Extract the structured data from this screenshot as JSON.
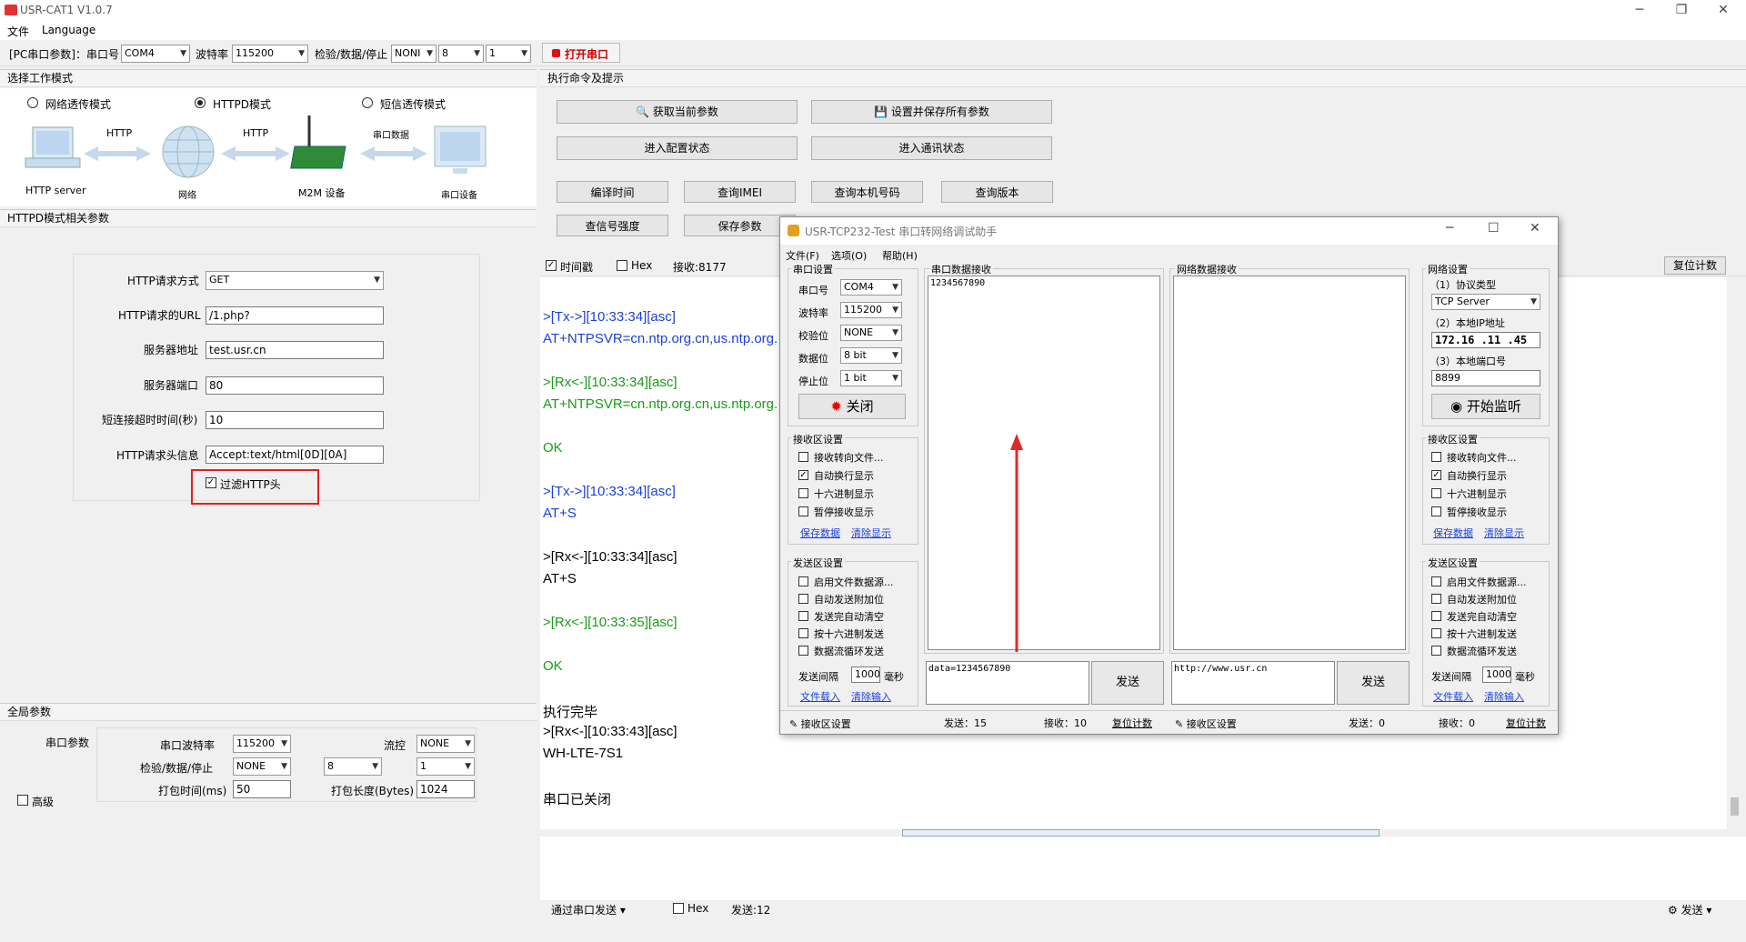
{
  "app": {
    "title": "USR-CAT1 V1.0.7"
  },
  "menu": {
    "file": "文件",
    "language": "Language"
  },
  "toolbar": {
    "pc_port_label": "[PC串口参数]：串口号",
    "port": "COM4",
    "baud_label": "波特率",
    "baud": "115200",
    "check_label": "检验/数据/停止",
    "parity": "NONI",
    "databits": "8",
    "stopbits": "1",
    "open_port": "打开串口"
  },
  "mode": {
    "header": "选择工作模式",
    "options": [
      "网络透传模式",
      "HTTPD模式",
      "短信透传模式"
    ],
    "selected_index": 1,
    "diagram": {
      "http1": "HTTP",
      "http2": "HTTP",
      "serial_data": "串口数据",
      "http_server": "HTTP server",
      "network": "网络",
      "m2m": "M2M 设备",
      "serial_device": "串口设备"
    }
  },
  "httpd": {
    "header": "HTTPD模式相关参数",
    "method_label": "HTTP请求方式",
    "method": "GET",
    "url_label": "HTTP请求的URL",
    "url": "/1.php?",
    "server_label": "服务器地址",
    "server": "test.usr.cn",
    "port_label": "服务器端口",
    "port": "80",
    "timeout_label": "短连接超时时间(秒)",
    "timeout": "10",
    "header_label": "HTTP请求头信息",
    "header_value": "Accept:text/html[0D][0A]",
    "filter_label": "过滤HTTP头"
  },
  "global": {
    "header": "全局参数",
    "serial_label": "串口参数",
    "baud_label": "串口波特率",
    "baud": "115200",
    "flow_label": "流控",
    "flow": "NONE",
    "check_label": "检验/数据/停止",
    "parity": "NONE",
    "databits": "8",
    "stopbits": "1",
    "pack_time_label": "打包时间(ms)",
    "pack_time": "50",
    "pack_len_label": "打包长度(Bytes)",
    "pack_len": "1024",
    "advanced": "高级"
  },
  "commands": {
    "header": "执行命令及提示",
    "get_params": "获取当前参数",
    "set_save": "设置并保存所有参数",
    "enter_config": "进入配置状态",
    "enter_comm": "进入通讯状态",
    "compile_time": "编译时间",
    "query_imei": "查询IMEI",
    "query_number": "查询本机号码",
    "query_version": "查询版本",
    "query_signal": "查信号强度",
    "save_params": "保存参数"
  },
  "logbar": {
    "timestamp": "时间戳",
    "hex": "Hex",
    "recv": "接收:8177",
    "reset": "复位计数"
  },
  "log": [
    {
      "text": ">[Tx->][10:33:34][asc]",
      "color": "blue"
    },
    {
      "text": "AT+NTPSVR=cn.ntp.org.cn,us.ntp.org.",
      "color": "blue"
    },
    {
      "text": ">[Rx<-][10:33:34][asc]",
      "color": "green"
    },
    {
      "text": "AT+NTPSVR=cn.ntp.org.cn,us.ntp.org.",
      "color": "green"
    },
    {
      "text": "OK",
      "color": "green"
    },
    {
      "text": ">[Tx->][10:33:34][asc]",
      "color": "blue"
    },
    {
      "text": "AT+S",
      "color": "blue"
    },
    {
      "text": ">[Rx<-][10:33:34][asc]",
      "color": "blk"
    },
    {
      "text": "AT+S",
      "color": "blk"
    },
    {
      "text": ">[Rx<-][10:33:35][asc]",
      "color": "green"
    },
    {
      "text": "OK",
      "color": "green"
    },
    {
      "text": "执行完毕",
      "color": "blk"
    },
    {
      "text": ">[Rx<-][10:33:43][asc]",
      "color": "blk"
    },
    {
      "text": "WH-LTE-7S1",
      "color": "blk"
    },
    {
      "text": "串口已关闭",
      "color": "blk"
    }
  ],
  "sendbar": {
    "via": "通过串口发送",
    "hex": "Hex",
    "sent": "发送:12",
    "send": "发送"
  },
  "dialog": {
    "title": "USR-TCP232-Test 串口转网络调试助手",
    "menu": [
      "文件(F)",
      "选项(O)",
      "帮助(H)"
    ],
    "serial_settings": "串口设置",
    "port_label": "串口号",
    "port": "COM4",
    "baud_label": "波特率",
    "baud": "115200",
    "parity_label": "校验位",
    "parity": "NONE",
    "data_label": "数据位",
    "data": "8 bit",
    "stop_label": "停止位",
    "stop": "1 bit",
    "close": "关闭",
    "recv_settings": "接收区设置",
    "recv_opts": [
      "接收转向文件...",
      "自动换行显示",
      "十六进制显示",
      "暂停接收显示"
    ],
    "recv_checked": [
      false,
      true,
      false,
      false
    ],
    "save_data": "保存数据",
    "clear_display": "清除显示",
    "send_settings": "发送区设置",
    "send_opts": [
      "启用文件数据源...",
      "自动发送附加位",
      "发送完自动清空",
      "按十六进制发送",
      "数据流循环发送"
    ],
    "interval_label": "发送间隔",
    "interval": "1000",
    "ms": "毫秒",
    "file_load": "文件载入",
    "clear_input": "清除输入",
    "serial_recv": "串口数据接收",
    "serial_recv_text": "1234567890",
    "serial_send_text": "data=1234567890",
    "net_recv": "网络数据接收",
    "net_send_text": "http://www.usr.cn",
    "send": "发送",
    "net_settings": "网络设置",
    "protocol_label": "（1）协议类型",
    "protocol": "TCP Server",
    "ip_label": "（2）本地IP地址",
    "ip": "172.16 .11 .45",
    "port2_label": "（3）本地端口号",
    "port2": "8899",
    "start_listen": "开始监听",
    "status_recv_settings": "接收区设置",
    "left_sent": "发送：15",
    "left_recv": "接收：10",
    "reset": "复位计数",
    "right_sent": "发送：0",
    "right_recv": "接收：0"
  }
}
